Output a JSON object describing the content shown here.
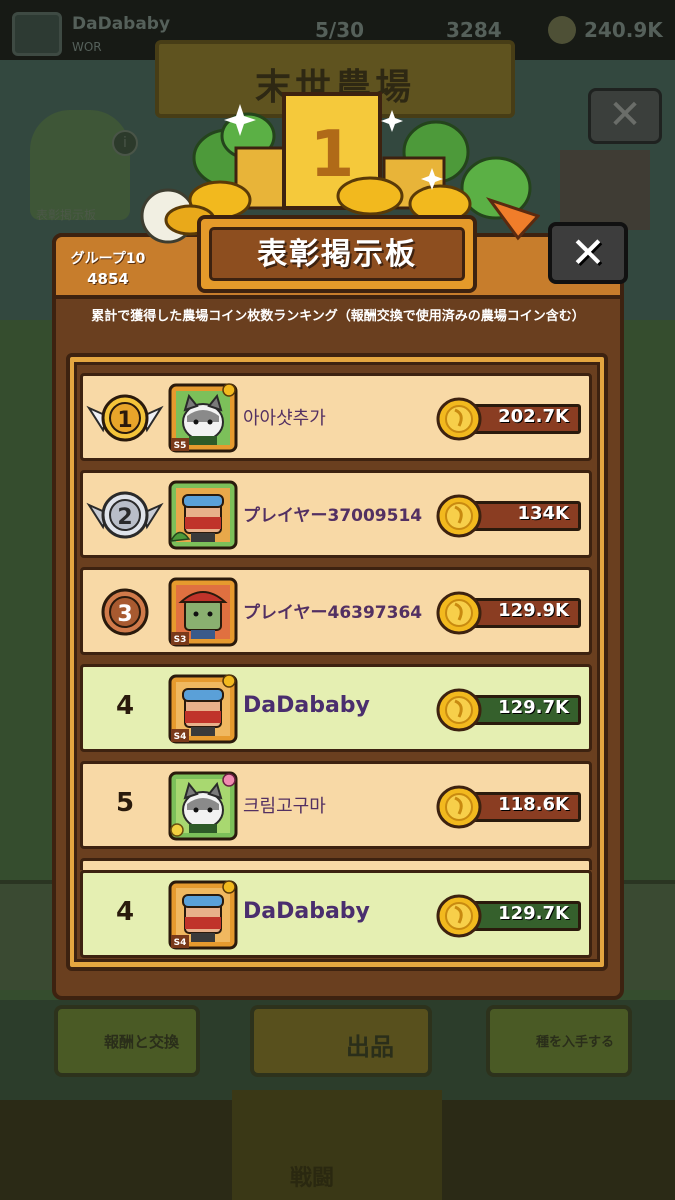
{
  "background": {
    "player_name": "DaDababy",
    "player_sub": "WOR",
    "stat_a": "5/30",
    "stat_b": "3284",
    "stat_c": "240.9K",
    "farm_title": "末世農場",
    "notice_label": "表彰掲示板",
    "info_icon": "i",
    "close_icon": "✕",
    "btn_rewards": "報酬と交換",
    "btn_sell": "出品",
    "btn_seeds": "種を入手する",
    "tab_center": "戦闘"
  },
  "modal": {
    "title": "表彰掲示板",
    "group_label": "グループ10",
    "group_score": "4854",
    "close_icon": "✕",
    "subtitle": "累計で獲得した農場コイン枚数ランキング（報酬交換で使用済みの農場コイン含む）",
    "trophy_rank": "1"
  },
  "rankings": [
    {
      "rank": "1",
      "name": "아아샷추가",
      "score": "202.7K",
      "badge": "S5",
      "avatar_icon": "cat-avatar-icon",
      "medal": "gold"
    },
    {
      "rank": "2",
      "name": "プレイヤー37009514",
      "score": "134K",
      "badge": "",
      "avatar_icon": "goggles-avatar-icon",
      "medal": "silver"
    },
    {
      "rank": "3",
      "name": "プレイヤー46397364",
      "score": "129.9K",
      "badge": "S3",
      "avatar_icon": "zombie-avatar-icon",
      "medal": "bronze"
    },
    {
      "rank": "4",
      "name": "DaDababy",
      "score": "129.7K",
      "badge": "S4",
      "avatar_icon": "goggles-avatar-icon",
      "medal": "none"
    },
    {
      "rank": "5",
      "name": "크림고구마",
      "score": "118.6K",
      "badge": "",
      "avatar_icon": "cat-avatar-icon",
      "medal": "none"
    }
  ],
  "self_row": {
    "rank": "4",
    "name": "DaDababy",
    "score": "129.7K",
    "badge": "S4",
    "avatar_icon": "goggles-avatar-icon"
  },
  "colors": {
    "panel_brown": "#6a3f1f",
    "row_normal": "#f8d9a6",
    "row_self": "#e5efb2",
    "coin_gold": "#f2b91e",
    "score_brown": "#8a3d22",
    "score_green": "#35602c"
  }
}
